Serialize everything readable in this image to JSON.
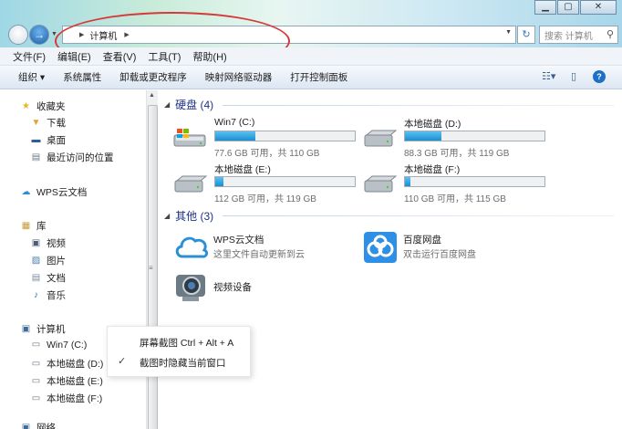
{
  "address": {
    "path": "计算机"
  },
  "search": {
    "placeholder": "搜索 计算机"
  },
  "menu": [
    "文件(F)",
    "编辑(E)",
    "查看(V)",
    "工具(T)",
    "帮助(H)"
  ],
  "commands": [
    "组织 ▾",
    "系统属性",
    "卸载或更改程序",
    "映射网络驱动器",
    "打开控制面板"
  ],
  "sidebar": {
    "favorites": "收藏夹",
    "fav_items": [
      "下载",
      "桌面",
      "最近访问的位置"
    ],
    "wps": "WPS云文档",
    "library": "库",
    "lib_items": [
      "视频",
      "图片",
      "文档",
      "音乐"
    ],
    "computer": "计算机",
    "comp_items": [
      "Win7 (C:)",
      "本地磁盘 (D:)",
      "本地磁盘 (E:)",
      "本地磁盘 (F:)"
    ],
    "network": "网络"
  },
  "groups": {
    "drives": "硬盘 (4)",
    "other": "其他 (3)"
  },
  "drives": [
    {
      "name": "Win7 (C:)",
      "info": "77.6 GB 可用，共 110 GB",
      "used": 0.29
    },
    {
      "name": "本地磁盘 (D:)",
      "info": "88.3 GB 可用，共 119 GB",
      "used": 0.26
    },
    {
      "name": "本地磁盘 (E:)",
      "info": "112 GB 可用，共 119 GB",
      "used": 0.06
    },
    {
      "name": "本地磁盘 (F:)",
      "info": "110 GB 可用，共 115 GB",
      "used": 0.04
    }
  ],
  "others": [
    {
      "name": "WPS云文档",
      "desc": "这里文件自动更新到云"
    },
    {
      "name": "百度网盘",
      "desc": "双击运行百度网盘"
    },
    {
      "name": "视频设备",
      "desc": ""
    }
  ],
  "context_menu": [
    "屏幕截图 Ctrl + Alt + A",
    "截图时隐藏当前窗口"
  ],
  "colors": {
    "annotation": "#d53a3a",
    "bar_fill": "#1a8fd1",
    "group_header": "#1e3287"
  }
}
